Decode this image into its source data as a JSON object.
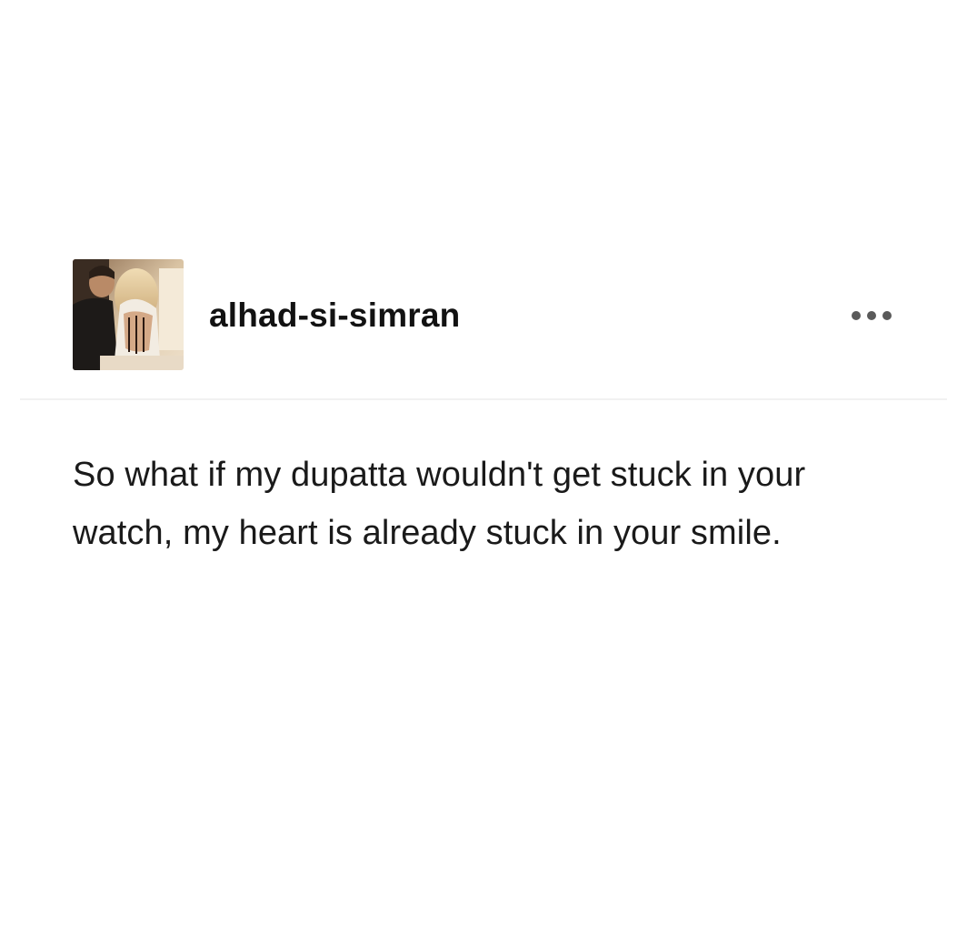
{
  "post": {
    "username": "alhad-si-simran",
    "body": "So what if my dupatta wouldn't get stuck in your watch, my heart is already stuck in your smile.",
    "more_icon": "ellipsis-horizontal-icon",
    "avatar_icon": "user-avatar-photo"
  },
  "colors": {
    "background": "#ffffff",
    "text": "#121212",
    "icon": "#5a5a5a",
    "divider": "#f1f1f1"
  }
}
